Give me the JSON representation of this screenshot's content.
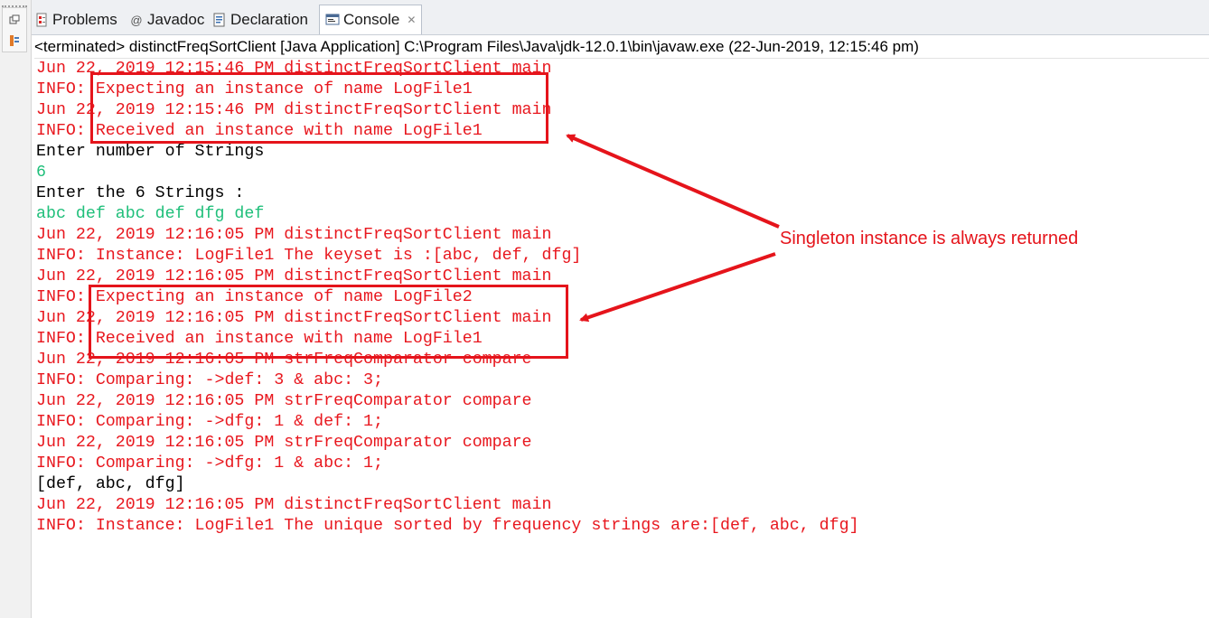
{
  "tabs": [
    {
      "label": "Problems",
      "icon": "problems-icon",
      "active": false
    },
    {
      "label": "Javadoc",
      "icon": "javadoc-icon",
      "active": false
    },
    {
      "label": "Declaration",
      "icon": "declaration-icon",
      "active": false
    },
    {
      "label": "Console",
      "icon": "console-icon",
      "active": true
    }
  ],
  "status": "<terminated> distinctFreqSortClient [Java Application] C:\\Program Files\\Java\\jdk-12.0.1\\bin\\javaw.exe (22-Jun-2019, 12:15:46 pm)",
  "console_lines": [
    {
      "text": "Jun 22, 2019 12:15:46 PM distinctFreqSortClient main",
      "color": "red"
    },
    {
      "text": "INFO: Expecting an instance of name LogFile1",
      "color": "red"
    },
    {
      "text": "Jun 22, 2019 12:15:46 PM distinctFreqSortClient main",
      "color": "red"
    },
    {
      "text": "INFO: Received an instance with name LogFile1",
      "color": "red"
    },
    {
      "text": "Enter number of Strings",
      "color": "black"
    },
    {
      "text": "6",
      "color": "green"
    },
    {
      "text": "Enter the 6 Strings :",
      "color": "black"
    },
    {
      "text": "abc def abc def dfg def",
      "color": "green"
    },
    {
      "text": "Jun 22, 2019 12:16:05 PM distinctFreqSortClient main",
      "color": "red"
    },
    {
      "text": "INFO: Instance: LogFile1 The keyset is :[abc, def, dfg]",
      "color": "red"
    },
    {
      "text": "Jun 22, 2019 12:16:05 PM distinctFreqSortClient main",
      "color": "red"
    },
    {
      "text": "INFO: Expecting an instance of name LogFile2",
      "color": "red"
    },
    {
      "text": "Jun 22, 2019 12:16:05 PM distinctFreqSortClient main",
      "color": "red"
    },
    {
      "text": "INFO: Received an instance with name LogFile1",
      "color": "red"
    },
    {
      "text": "Jun 22, 2019 12:16:05 PM strFreqComparator compare",
      "color": "red"
    },
    {
      "text": "INFO: Comparing: ->def: 3 & abc: 3;",
      "color": "red"
    },
    {
      "text": "Jun 22, 2019 12:16:05 PM strFreqComparator compare",
      "color": "red"
    },
    {
      "text": "INFO: Comparing: ->dfg: 1 & def: 1;",
      "color": "red"
    },
    {
      "text": "Jun 22, 2019 12:16:05 PM strFreqComparator compare",
      "color": "red"
    },
    {
      "text": "INFO: Comparing: ->dfg: 1 & abc: 1;",
      "color": "red"
    },
    {
      "text": "[def, abc, dfg]",
      "color": "black"
    },
    {
      "text": "Jun 22, 2019 12:16:05 PM distinctFreqSortClient main",
      "color": "red"
    },
    {
      "text": "INFO: Instance: LogFile1 The unique sorted by frequency strings are:[def, abc, dfg]",
      "color": "red"
    }
  ],
  "annotation": {
    "text": "Singleton instance is always returned",
    "color": "#e5141b"
  },
  "colors": {
    "stderr": "#e8171e",
    "stdout": "#000000",
    "stdin": "#1fbf7a"
  }
}
